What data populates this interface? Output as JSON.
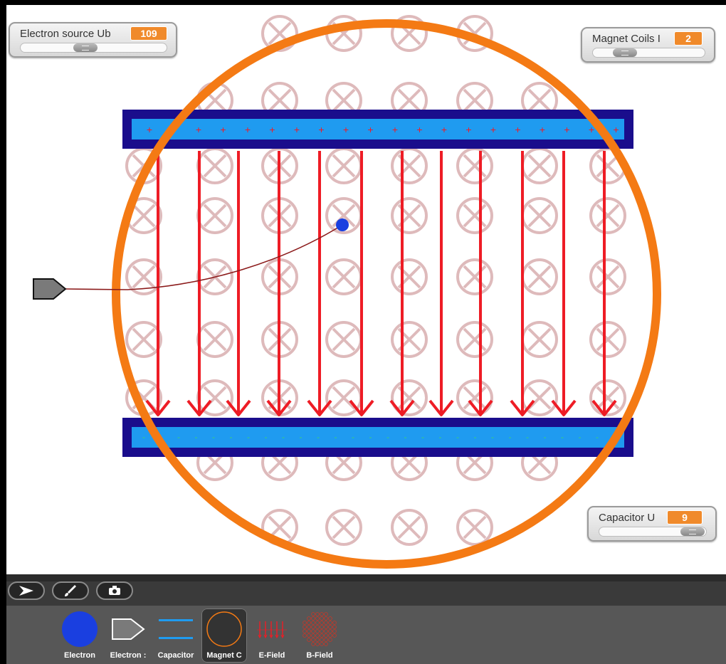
{
  "stage": {
    "watchers": {
      "electron_source": {
        "label": "Electron source Ub",
        "value": "109"
      },
      "magnet_coils": {
        "label": "Magnet Coils I",
        "value": "2"
      },
      "capacitor": {
        "label": "Capacitor U",
        "value": "9"
      }
    },
    "capacitor_top_sign": "+",
    "capacitor_bottom_sign": "-",
    "colors": {
      "magnet_ring": "#f47a14",
      "capacitor_frame": "#1a0d8c",
      "capacitor_plate": "#1f9bf0",
      "field_arrow": "#ee1c25",
      "b_field_symbol": "#d9aeb0",
      "electron": "#1a3fe0",
      "trajectory": "#8b1a1a"
    }
  },
  "toolbar": {
    "buttons": [
      {
        "icon": "arrow-right-icon"
      },
      {
        "icon": "paint-brush-icon"
      },
      {
        "icon": "camera-icon"
      }
    ]
  },
  "sprites": [
    {
      "name": "Electron",
      "icon": "electron-icon"
    },
    {
      "name": "Electron :",
      "icon": "electron-source-icon"
    },
    {
      "name": "Capacitor",
      "icon": "capacitor-icon"
    },
    {
      "name": "Magnet C",
      "icon": "magnet-coil-icon",
      "selected": true
    },
    {
      "name": "E-Field",
      "icon": "e-field-icon"
    },
    {
      "name": "B-Field",
      "icon": "b-field-icon"
    }
  ]
}
